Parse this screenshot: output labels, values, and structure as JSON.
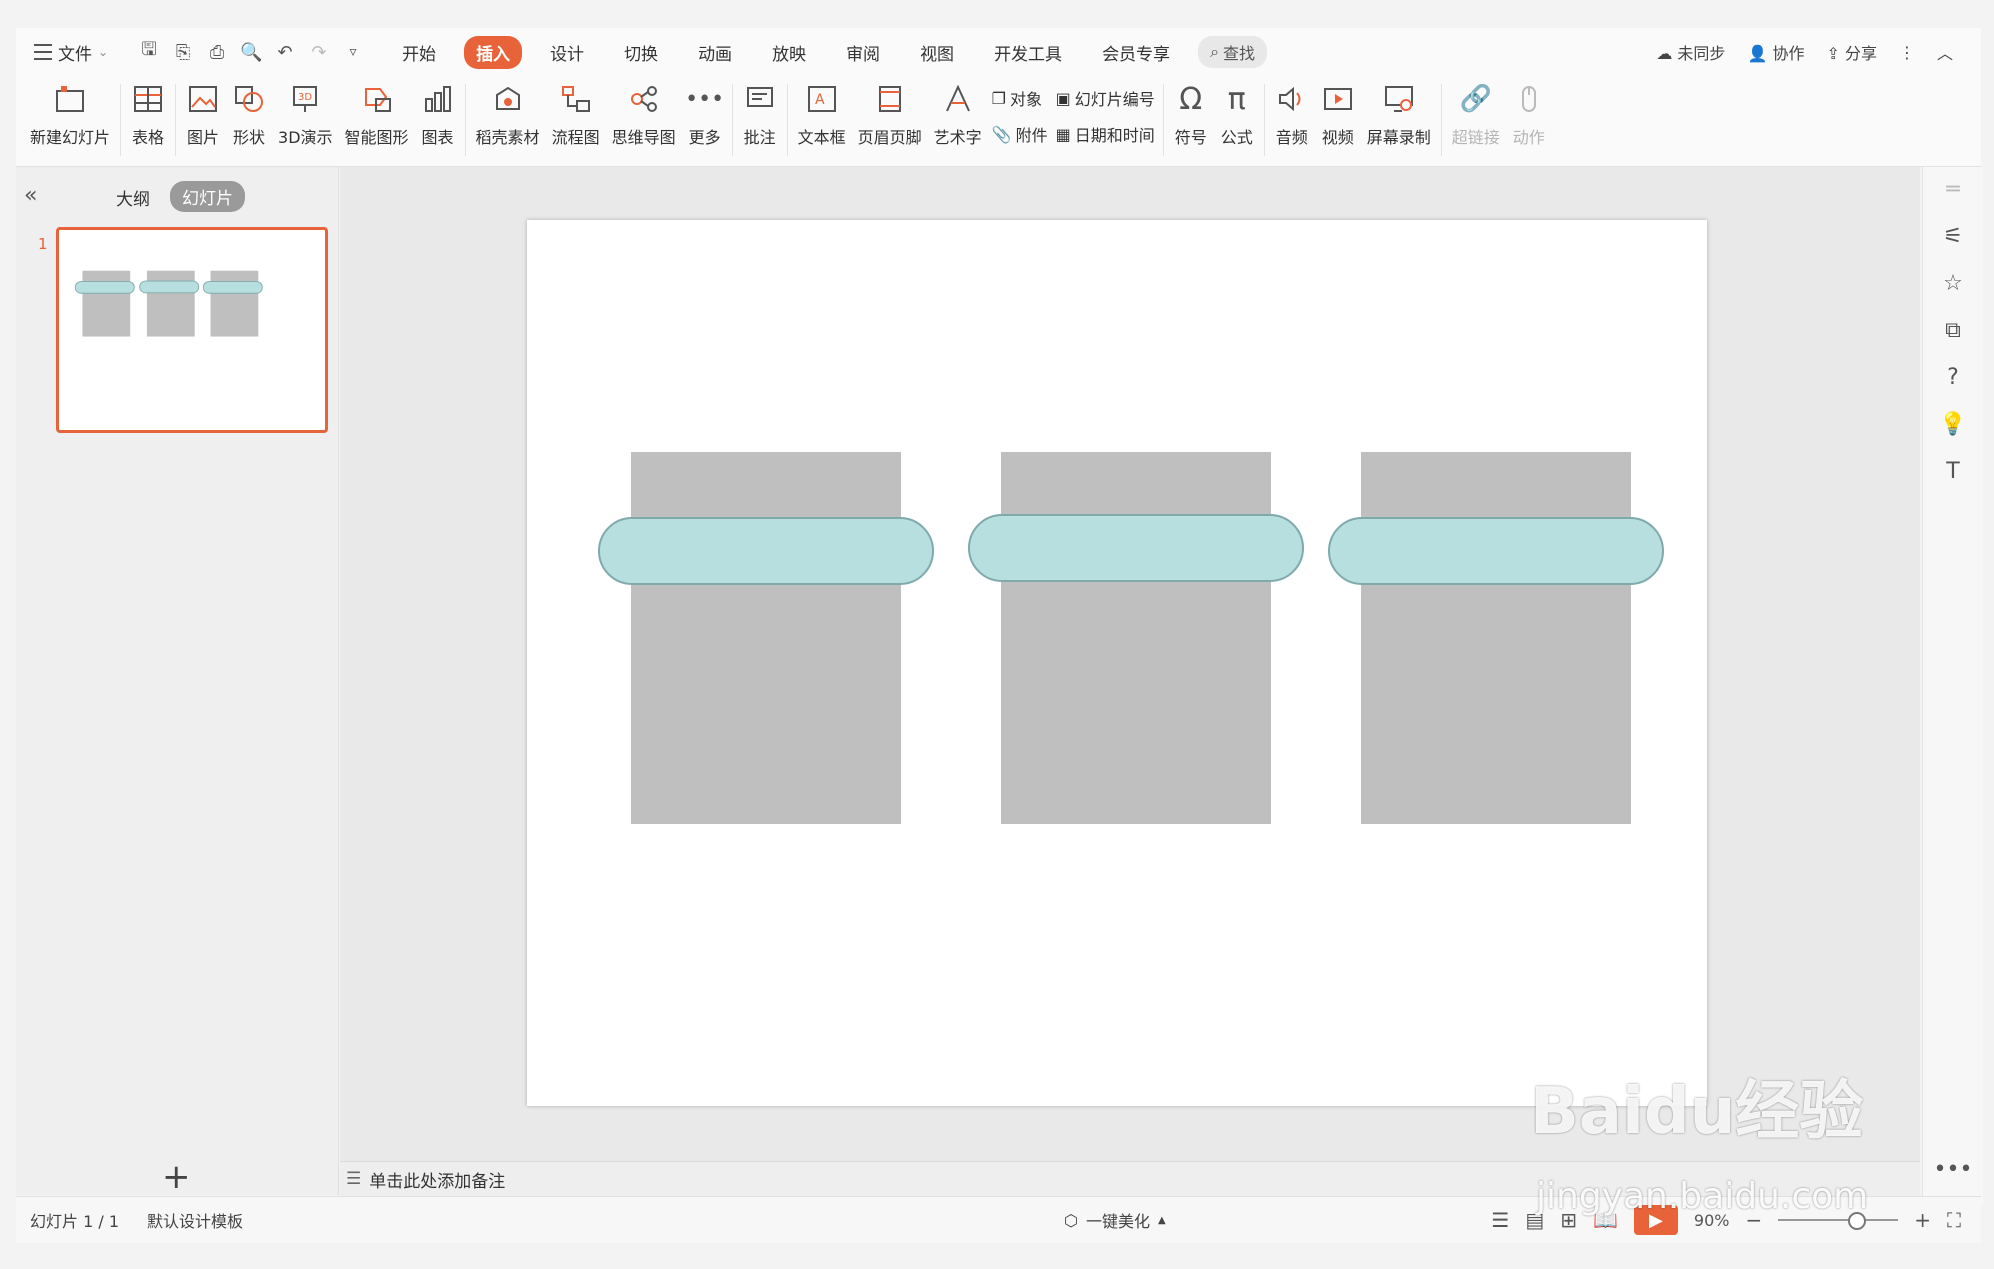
{
  "title_menu": {
    "file": "文件"
  },
  "tabs": [
    {
      "label": "开始"
    },
    {
      "label": "插入",
      "active": true
    },
    {
      "label": "设计"
    },
    {
      "label": "切换"
    },
    {
      "label": "动画"
    },
    {
      "label": "放映"
    },
    {
      "label": "审阅"
    },
    {
      "label": "视图"
    },
    {
      "label": "开发工具"
    },
    {
      "label": "会员专享"
    }
  ],
  "search": {
    "label": "查找"
  },
  "top_right": {
    "sync": "未同步",
    "collab": "协作",
    "share": "分享"
  },
  "ribbon": {
    "new_slide": "新建幻灯片",
    "table": "表格",
    "picture": "图片",
    "shape": "形状",
    "demo3d": "3D演示",
    "smartart": "智能图形",
    "chart": "图表",
    "material": "稻壳素材",
    "flowchart": "流程图",
    "mindmap": "思维导图",
    "more": "更多",
    "comment": "批注",
    "textbox": "文本框",
    "header_footer": "页眉页脚",
    "wordart": "艺术字",
    "object": "对象",
    "attachment": "附件",
    "slide_number": "幻灯片编号",
    "datetime": "日期和时间",
    "symbol": "符号",
    "formula": "公式",
    "audio": "音频",
    "video": "视频",
    "screen_record": "屏幕录制",
    "hyperlink": "超链接",
    "action": "动作"
  },
  "left_panel": {
    "outline_tab": "大纲",
    "slides_tab": "幻灯片",
    "slide_number": "1"
  },
  "notes": {
    "placeholder": "单击此处添加备注"
  },
  "status": {
    "slide_info": "幻灯片 1 / 1",
    "template": "默认设计模板",
    "beautify": "一键美化",
    "zoom": "90%"
  },
  "watermark": {
    "line1": "Baidu经验",
    "line2": "jingyan.baidu.com"
  },
  "colors": {
    "accent": "#e8633a",
    "rect": "#bfbfbf",
    "pill_fill": "#b8dfe0",
    "pill_stroke": "#7fa9ab"
  }
}
